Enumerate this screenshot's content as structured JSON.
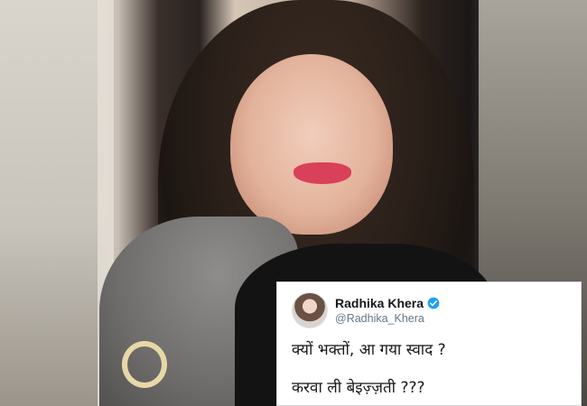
{
  "tweet": {
    "display_name": "Radhika Khera",
    "handle": "@Radhika_Khera",
    "lines": [
      "क्यों भक्तों, आ गया स्वाद ?",
      "करवा ली बेइज़्ज़ती ???"
    ],
    "verified_icon": "verified-badge-icon",
    "accent_color": "#1da1f2"
  }
}
